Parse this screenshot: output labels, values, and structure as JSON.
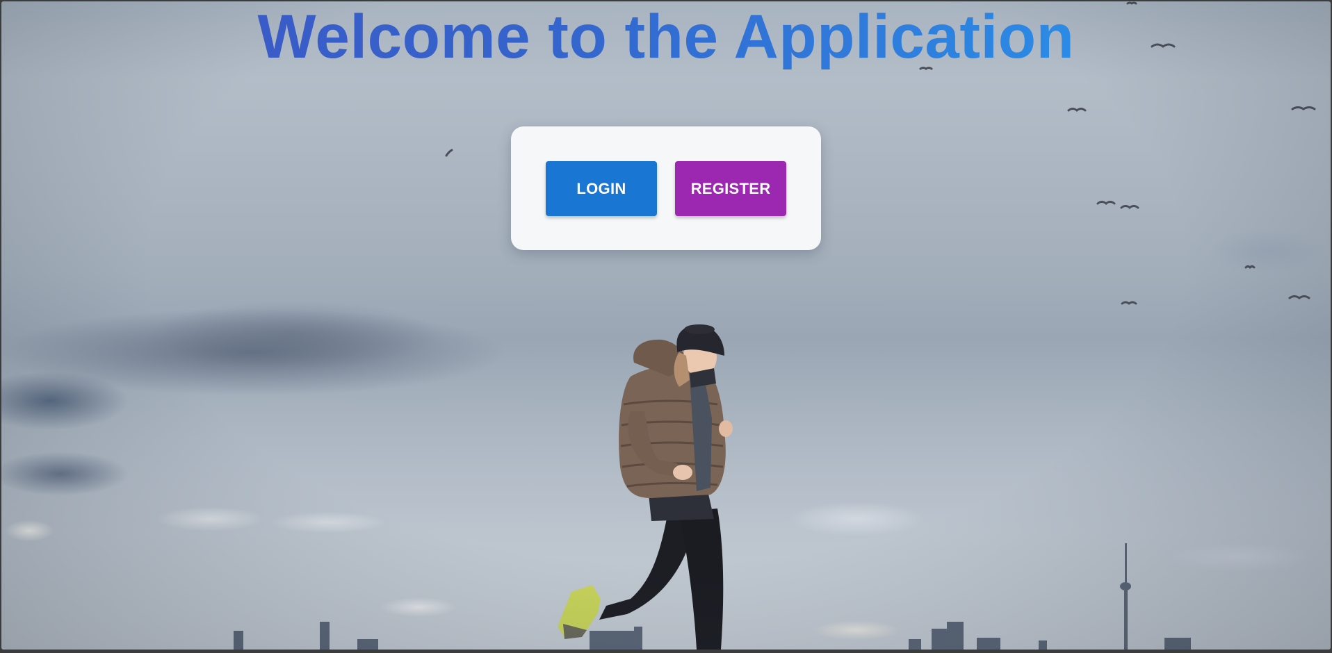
{
  "page": {
    "title": "Welcome to the Application"
  },
  "auth_card": {
    "login_label": "LOGIN",
    "register_label": "REGISTER"
  },
  "colors": {
    "title_gradient_start": "#3e55c4",
    "title_gradient_end": "#2196f3",
    "login_button": "#1976d2",
    "register_button": "#9c27b0",
    "card_background": "#f6f7f9"
  },
  "background": {
    "image_subject": "woman jogging in puffer jacket under cloudy sky with city skyline"
  }
}
